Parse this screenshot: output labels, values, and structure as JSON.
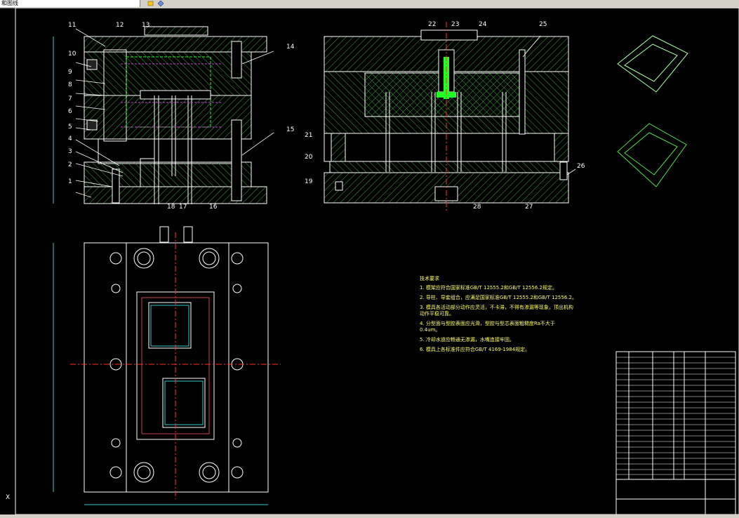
{
  "toolbar": {
    "layer_field": "和图线"
  },
  "colors": {
    "background": "#000000",
    "outline": "#ffffff",
    "hatch": "#3fa83f",
    "center": "#ff3030",
    "dimension": "#33cccc",
    "hidden": "#cc44cc",
    "highlight": "#22ff22",
    "text": "#ffff66"
  },
  "part_labels_left": [
    "1",
    "2",
    "3",
    "4",
    "5",
    "6",
    "7",
    "8",
    "9",
    "10",
    "11",
    "12",
    "13",
    "14",
    "15",
    "16",
    "17",
    "18"
  ],
  "part_labels_right": [
    "19",
    "20",
    "21",
    "22",
    "23",
    "24",
    "25",
    "26",
    "27",
    "28"
  ],
  "tech_requirements": {
    "heading": "技术要求",
    "items": [
      "1. 模架应符合国家标准GB/T 12555.2和GB/T 12556.2规定。",
      "2. 导柱、导套组合，应满足国家标准GB/T 12555.2和GB/T 12556.2。",
      "3. 模具各活动部分动作应灵活，不卡滞，不得有渗漏等现象，顶出机构",
      "   动作平稳可靠。",
      "4. 分型面与型腔表面应光滑，型腔与型芯表面粗糙度Ra不大于",
      "   0.4um。",
      "5. 冷却水道应畅通无渗漏，水嘴连接牢固。",
      "6. 模具上各标准件应符合GB/T 4169-1984规定。"
    ]
  },
  "ucs_label": "X"
}
